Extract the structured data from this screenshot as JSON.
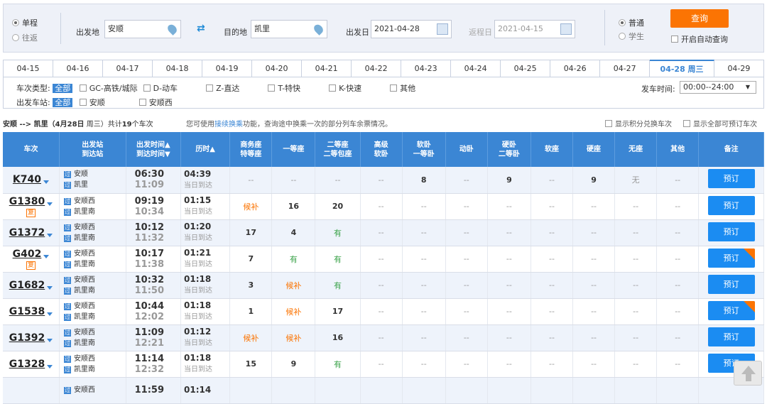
{
  "trip_type": {
    "single": "单程",
    "round": "往返"
  },
  "from": {
    "label": "出发地",
    "value": "安顺"
  },
  "to": {
    "label": "目的地",
    "value": "凯里"
  },
  "depart": {
    "label": "出发日",
    "value": "2021-04-28"
  },
  "return": {
    "label": "返程日",
    "value": "2021-04-15"
  },
  "passenger": {
    "normal": "普通",
    "student": "学生"
  },
  "query_label": "查询",
  "auto_query": "开启自动查询",
  "dates": [
    "04-15",
    "04-16",
    "04-17",
    "04-18",
    "04-19",
    "04-20",
    "04-21",
    "04-22",
    "04-23",
    "04-24",
    "04-25",
    "04-26",
    "04-27",
    "04-28 周三",
    "04-29"
  ],
  "filters": {
    "type_label": "车次类型:",
    "all": "全部",
    "types": [
      "GC-高铁/城际",
      "D-动车",
      "Z-直达",
      "T-特快",
      "K-快速",
      "其他"
    ],
    "station_label": "出发车站:",
    "stations": [
      "安顺",
      "安顺西"
    ],
    "time_label": "发车时间:",
    "time_value": "00:00--24:00"
  },
  "summary": {
    "route": "安顺 --> 凯里（",
    "date": "4月28日",
    "weekday": " 周三）共计",
    "count": "19",
    "suffix": "个车次",
    "tip_pre": "您可使用",
    "tip_link": "接续换乘",
    "tip_post": "功能，查询途中换乘一次的部分列车余票情况。",
    "opt1": "显示积分兑换车次",
    "opt2": "显示全部可预订车次"
  },
  "headers": [
    "车次",
    "出发站\n到达站",
    "出发时间▲\n到达时间▼",
    "历时▲",
    "商务座\n特等座",
    "一等座",
    "二等座\n二等包座",
    "高级\n软卧",
    "软卧\n一等卧",
    "动卧",
    "硬卧\n二等卧",
    "软座",
    "硬座",
    "无座",
    "其他",
    "备注"
  ],
  "trains": [
    {
      "no": "K740",
      "fu": "",
      "from": "安顺",
      "to": "凯里",
      "dep": "06:30",
      "arr": "11:09",
      "dur": "04:39",
      "day": "当日到达",
      "seats": [
        "--",
        "--",
        "--",
        "--",
        "8",
        "--",
        "9",
        "--",
        "9",
        "无",
        "--"
      ],
      "book": "预订",
      "dui": false
    },
    {
      "no": "G1380",
      "fu": "复",
      "from": "安顺西",
      "to": "凯里南",
      "dep": "09:19",
      "arr": "10:34",
      "dur": "01:15",
      "day": "当日到达",
      "seats": [
        "候补",
        "16",
        "20",
        "--",
        "--",
        "--",
        "--",
        "--",
        "--",
        "--",
        "--"
      ],
      "book": "预订",
      "dui": false
    },
    {
      "no": "G1372",
      "fu": "",
      "from": "安顺西",
      "to": "凯里南",
      "dep": "10:12",
      "arr": "11:32",
      "dur": "01:20",
      "day": "当日到达",
      "seats": [
        "17",
        "4",
        "有",
        "--",
        "--",
        "--",
        "--",
        "--",
        "--",
        "--",
        "--"
      ],
      "book": "预订",
      "dui": false
    },
    {
      "no": "G402",
      "fu": "复",
      "from": "安顺西",
      "to": "凯里南",
      "dep": "10:17",
      "arr": "11:38",
      "dur": "01:21",
      "day": "当日到达",
      "seats": [
        "7",
        "有",
        "有",
        "--",
        "--",
        "--",
        "--",
        "--",
        "--",
        "--",
        "--"
      ],
      "book": "预订",
      "dui": true
    },
    {
      "no": "G1682",
      "fu": "",
      "from": "安顺西",
      "to": "凯里南",
      "dep": "10:32",
      "arr": "11:50",
      "dur": "01:18",
      "day": "当日到达",
      "seats": [
        "3",
        "候补",
        "有",
        "--",
        "--",
        "--",
        "--",
        "--",
        "--",
        "--",
        "--"
      ],
      "book": "预订",
      "dui": false
    },
    {
      "no": "G1538",
      "fu": "",
      "from": "安顺西",
      "to": "凯里南",
      "dep": "10:44",
      "arr": "12:02",
      "dur": "01:18",
      "day": "当日到达",
      "seats": [
        "1",
        "候补",
        "17",
        "--",
        "--",
        "--",
        "--",
        "--",
        "--",
        "--",
        "--"
      ],
      "book": "预订",
      "dui": true
    },
    {
      "no": "G1392",
      "fu": "",
      "from": "安顺西",
      "to": "凯里南",
      "dep": "11:09",
      "arr": "12:21",
      "dur": "01:12",
      "day": "当日到达",
      "seats": [
        "候补",
        "候补",
        "16",
        "--",
        "--",
        "--",
        "--",
        "--",
        "--",
        "--",
        "--"
      ],
      "book": "预订",
      "dui": false
    },
    {
      "no": "G1328",
      "fu": "",
      "from": "安顺西",
      "to": "凯里南",
      "dep": "11:14",
      "arr": "12:32",
      "dur": "01:18",
      "day": "当日到达",
      "seats": [
        "15",
        "9",
        "有",
        "--",
        "--",
        "--",
        "--",
        "--",
        "--",
        "--",
        "--"
      ],
      "book": "预订",
      "dui": false
    },
    {
      "no": "",
      "fu": "",
      "from": "安顺西",
      "to": "",
      "dep": "11:59",
      "arr": "",
      "dur": "01:14",
      "day": "",
      "seats": [
        "",
        "",
        "",
        "",
        "",
        "",
        "",
        "",
        "",
        "",
        ""
      ],
      "book": "",
      "dui": false
    }
  ],
  "badges": {
    "from": "始",
    "pass": "过"
  },
  "colors": {
    "accent": "#3b86d4",
    "orange": "#fb7403",
    "book": "#1b8cf2"
  }
}
